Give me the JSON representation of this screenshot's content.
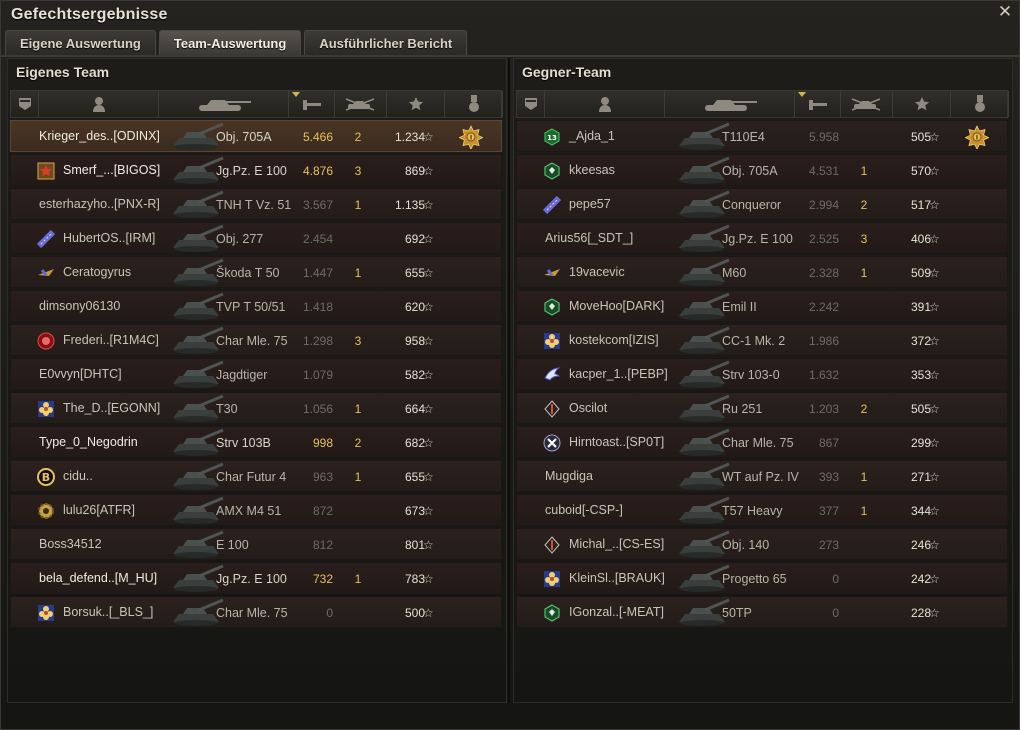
{
  "window": {
    "title": "Gefechtsergebnisse",
    "close_glyph": "✕"
  },
  "tabs": [
    {
      "label": "Eigene Auswertung",
      "active": false
    },
    {
      "label": "Team-Auswertung",
      "active": true
    },
    {
      "label": "Ausführlicher Bericht",
      "active": false
    }
  ],
  "columns": [
    "squad-icon",
    "player-icon",
    "tank-icon",
    "damage-icon",
    "kills-icon",
    "xp-star-icon",
    "medal-icon"
  ],
  "colors": {
    "accent": "#e8c05a",
    "self_row": "#4a3524",
    "row": "#2c211e"
  },
  "own_team": {
    "title": "Eigenes Team",
    "rows": [
      {
        "player": "Krieger_des..[ODINX]",
        "vehicle": "Obj. 705A",
        "damage": "5.466",
        "kills": "2",
        "xp": "1.234",
        "medal": true,
        "clan": "",
        "self": true,
        "dmg_top": true
      },
      {
        "player": "Smerf_...[BIGOS]",
        "vehicle": "Jg.Pz. E 100",
        "damage": "4.876",
        "kills": "3",
        "xp": "869",
        "medal": false,
        "clan": "shield",
        "bright": true,
        "dmg_top": true
      },
      {
        "player": "esterhazyho..[PNX-R]",
        "vehicle": "TNH T Vz. 51",
        "damage": "3.567",
        "kills": "1",
        "xp": "1.135",
        "medal": false,
        "clan": ""
      },
      {
        "player": "HubertOS..[IRM]",
        "vehicle": "Obj. 277",
        "damage": "2.454",
        "kills": "",
        "xp": "692",
        "medal": false,
        "clan": "flag"
      },
      {
        "player": "Ceratogyrus",
        "vehicle": "Škoda T 50",
        "damage": "1.447",
        "kills": "1",
        "xp": "655",
        "medal": false,
        "clan": "plane"
      },
      {
        "player": "dimsony06130",
        "vehicle": "TVP T 50/51",
        "damage": "1.418",
        "kills": "",
        "xp": "620",
        "medal": false,
        "clan": ""
      },
      {
        "player": "Frederi..[R1M4C]",
        "vehicle": "Char Mle. 75",
        "damage": "1.298",
        "kills": "3",
        "xp": "958",
        "medal": false,
        "clan": "red"
      },
      {
        "player": "E0vvyn[DHTC]",
        "vehicle": "Jagdtiger",
        "damage": "1.079",
        "kills": "",
        "xp": "582",
        "medal": false,
        "clan": ""
      },
      {
        "player": "The_D..[EGONN]",
        "vehicle": "T30",
        "damage": "1.056",
        "kills": "1",
        "xp": "664",
        "medal": false,
        "clan": "flower"
      },
      {
        "player": "Type_0_Negodrin",
        "vehicle": "Strv 103B",
        "damage": "998",
        "kills": "2",
        "xp": "682",
        "medal": false,
        "clan": "",
        "bright": true,
        "dmg_top": true
      },
      {
        "player": "cidu..",
        "vehicle": "Char Futur 4",
        "damage": "963",
        "kills": "1",
        "xp": "655",
        "medal": false,
        "clan": "bcoin"
      },
      {
        "player": "lulu26[ATFR]",
        "vehicle": "AMX M4 51",
        "damage": "872",
        "kills": "",
        "xp": "673",
        "medal": false,
        "clan": "gear"
      },
      {
        "player": "Boss34512",
        "vehicle": "E 100",
        "damage": "812",
        "kills": "",
        "xp": "801",
        "medal": false,
        "clan": ""
      },
      {
        "player": "bela_defend..[M_HU]",
        "vehicle": "Jg.Pz. E 100",
        "damage": "732",
        "kills": "1",
        "xp": "783",
        "medal": false,
        "clan": "",
        "bright": true,
        "dmg_top": true
      },
      {
        "player": "Borsuk..[_BLS_]",
        "vehicle": "Char Mle. 75",
        "damage": "0",
        "kills": "",
        "xp": "500",
        "medal": false,
        "clan": "flower"
      }
    ]
  },
  "enemy_team": {
    "title": "Gegner-Team",
    "rows": [
      {
        "player": "_Ajda_1",
        "vehicle": "T110E4",
        "damage": "5.958",
        "kills": "",
        "xp": "505",
        "medal": true,
        "clan": "hex13"
      },
      {
        "player": "kkeesas",
        "vehicle": "Obj. 705A",
        "damage": "4.531",
        "kills": "1",
        "xp": "570",
        "medal": false,
        "clan": "hexg"
      },
      {
        "player": "pepe57",
        "vehicle": "Conqueror",
        "damage": "2.994",
        "kills": "2",
        "xp": "517",
        "medal": false,
        "clan": "flag"
      },
      {
        "player": "Arius56[_SDT_]",
        "vehicle": "Jg.Pz. E 100",
        "damage": "2.525",
        "kills": "3",
        "xp": "406",
        "medal": false,
        "clan": ""
      },
      {
        "player": "19vacevic",
        "vehicle": "M60",
        "damage": "2.328",
        "kills": "1",
        "xp": "509",
        "medal": false,
        "clan": "plane"
      },
      {
        "player": "MoveHoo[DARK]",
        "vehicle": "Emil II",
        "damage": "2.242",
        "kills": "",
        "xp": "391",
        "medal": false,
        "clan": "hexg"
      },
      {
        "player": "kostekcom[IZIS]",
        "vehicle": "CC-1 Mk. 2",
        "damage": "1.986",
        "kills": "",
        "xp": "372",
        "medal": false,
        "clan": "flower"
      },
      {
        "player": "kacper_1..[PEBP]",
        "vehicle": "Strv 103-0",
        "damage": "1.632",
        "kills": "",
        "xp": "353",
        "medal": false,
        "clan": "wing"
      },
      {
        "player": "Oscilot",
        "vehicle": "Ru 251",
        "damage": "1.203",
        "kills": "2",
        "xp": "505",
        "medal": false,
        "clan": "diamond"
      },
      {
        "player": "Hirntoast..[SP0T]",
        "vehicle": "Char Mle. 75",
        "damage": "867",
        "kills": "",
        "xp": "299",
        "medal": false,
        "clan": "xcircle"
      },
      {
        "player": "Mugdiga",
        "vehicle": "WT auf Pz. IV",
        "damage": "393",
        "kills": "1",
        "xp": "271",
        "medal": false,
        "clan": ""
      },
      {
        "player": "cuboid[-CSP-]",
        "vehicle": "T57 Heavy",
        "damage": "377",
        "kills": "1",
        "xp": "344",
        "medal": false,
        "clan": ""
      },
      {
        "player": "Michal_..[CS-ES]",
        "vehicle": "Obj. 140",
        "damage": "273",
        "kills": "",
        "xp": "246",
        "medal": false,
        "clan": "diamond"
      },
      {
        "player": "KleinSl..[BRAUK]",
        "vehicle": "Progetto 65",
        "damage": "0",
        "kills": "",
        "xp": "242",
        "medal": false,
        "clan": "flower"
      },
      {
        "player": "IGonzal..[-MEAT]",
        "vehicle": "50TP",
        "damage": "0",
        "kills": "",
        "xp": "228",
        "medal": false,
        "clan": "hexg"
      }
    ]
  }
}
